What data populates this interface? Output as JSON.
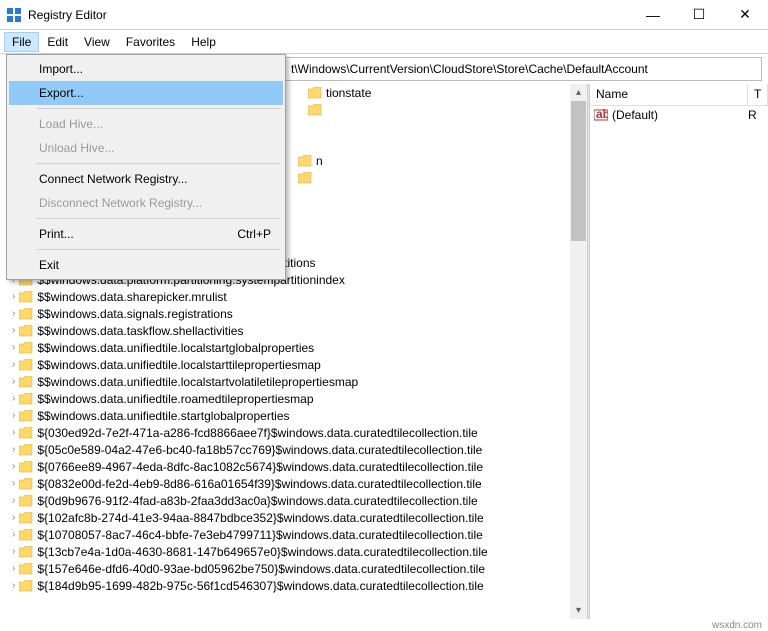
{
  "title": "Registry Editor",
  "win": {
    "min": "—",
    "max": "☐",
    "close": "✕"
  },
  "menu": [
    "File",
    "Edit",
    "View",
    "Favorites",
    "Help"
  ],
  "address": "t\\Windows\\CurrentVersion\\CloudStore\\Store\\Cache\\DefaultAccount",
  "fmenu": {
    "import": "Import...",
    "export": "Export...",
    "load": "Load Hive...",
    "unload": "Unload Hive...",
    "connect": "Connect Network Registry...",
    "disconnect": "Disconnect Network Registry...",
    "print": "Print...",
    "print_sc": "Ctrl+P",
    "exit": "Exit"
  },
  "list": {
    "hdr_name": "Name",
    "hdr_type": "T",
    "default": "(Default)",
    "default_type": "R"
  },
  "tree_visible": [
    "tionstate",
    "",
    "n",
    "",
    "$$windows.data.platform.partitioning.activepartitions",
    "$$windows.data.platform.partitioning.systempartitionindex",
    "$$windows.data.sharepicker.mrulist",
    "$$windows.data.signals.registrations",
    "$$windows.data.taskflow.shellactivities",
    "$$windows.data.unifiedtile.localstartglobalproperties",
    "$$windows.data.unifiedtile.localstarttilepropertiesmap",
    "$$windows.data.unifiedtile.localstartvolatiletilepropertiesmap",
    "$$windows.data.unifiedtile.roamedtilepropertiesmap",
    "$$windows.data.unifiedtile.startglobalproperties",
    "${030ed92d-7e2f-471a-a286-fcd8866aee7f}$windows.data.curatedtilecollection.tile",
    "${05c0e589-04a2-47e6-bc40-fa18b57cc769}$windows.data.curatedtilecollection.tile",
    "${0766ee89-4967-4eda-8dfc-8ac1082c5674}$windows.data.curatedtilecollection.tile",
    "${0832e00d-fe2d-4eb9-8d86-616a01654f39}$windows.data.curatedtilecollection.tile",
    "${0d9b9676-91f2-4fad-a83b-2faa3dd3ac0a}$windows.data.curatedtilecollection.tile",
    "${102afc8b-274d-41e3-94aa-8847bdbce352}$windows.data.curatedtilecollection.tile",
    "${10708057-8ac7-46c4-bbfe-7e3eb4799711}$windows.data.curatedtilecollection.tile",
    "${13cb7e4a-1d0a-4630-8681-147b649657e0}$windows.data.curatedtilecollection.tile",
    "${157e646e-dfd6-40d0-93ae-bd05962be750}$windows.data.curatedtilecollection.tile",
    "${184d9b95-1699-482b-975c-56f1cd546307}$windows.data.curatedtilecollection.tile"
  ],
  "watermark": "wsxdn.com"
}
